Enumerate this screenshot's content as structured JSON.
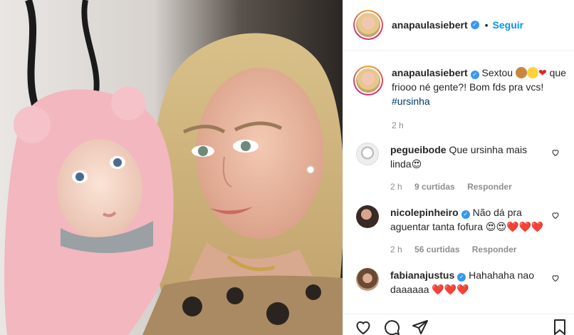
{
  "post": {
    "username": "anapaulasiebert",
    "follow_label": "Seguir",
    "separator": "•"
  },
  "caption": {
    "username": "anapaulasiebert",
    "text_1": "Sextou",
    "text_2": "que friooo né gente?! Bom fds pra vcs!",
    "hashtag": "#ursinha",
    "time": "2 h"
  },
  "comments": [
    {
      "username": "pegueibode",
      "text": "Que ursinha mais linda😍",
      "time": "2 h",
      "likes": "9 curtidas",
      "reply_label": "Responder"
    },
    {
      "username": "nicolepinheiro",
      "text": "Não dá pra aguentar tanta fofura 😍😍❤️❤️❤️",
      "time": "2 h",
      "likes": "56 curtidas",
      "reply_label": "Responder"
    },
    {
      "username": "fabianajustus",
      "text": "Hahahaha nao daaaaaa ❤️❤️❤️"
    }
  ],
  "icons": {
    "like": "heart-outline-icon",
    "comment": "comment-bubble-icon",
    "share": "paper-plane-icon",
    "save": "bookmark-icon",
    "verified": "verified-badge-icon"
  },
  "colors": {
    "accent": "#0095f6",
    "verified": "#3897f0",
    "muted": "#8e8e8e",
    "hashtag": "#00376b"
  }
}
